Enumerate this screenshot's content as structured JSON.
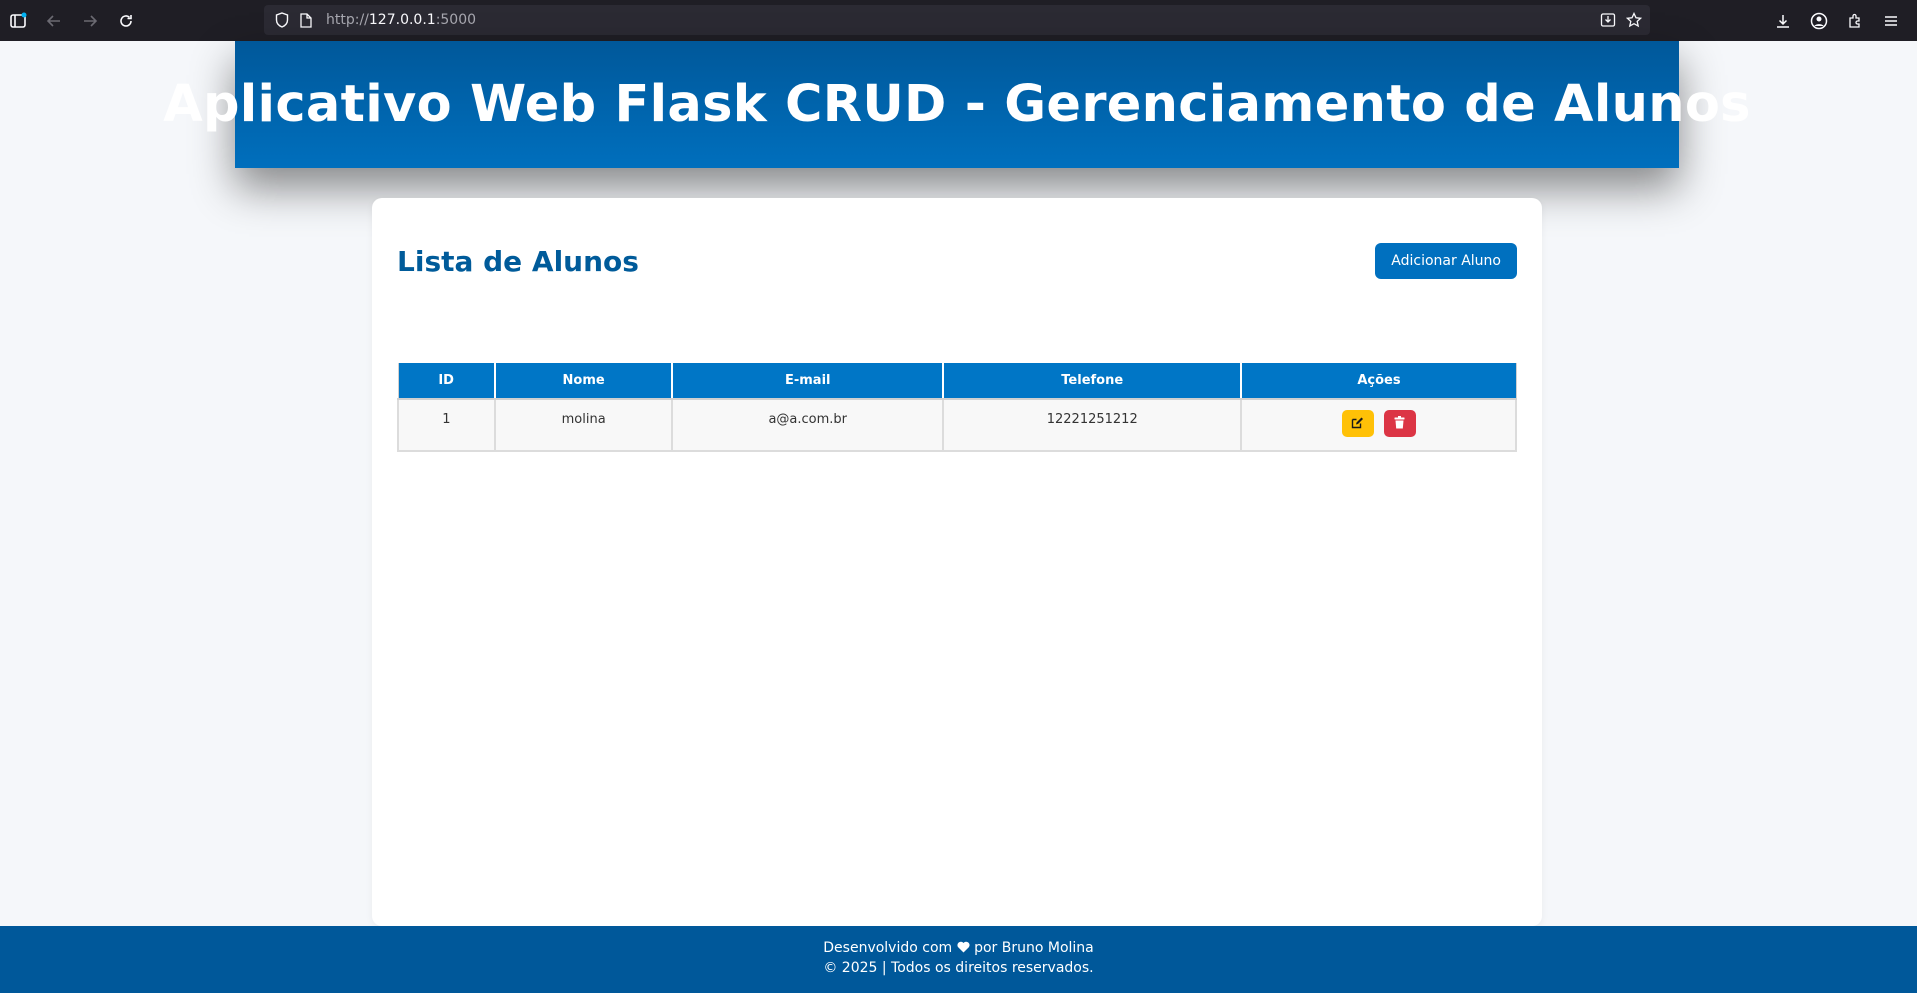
{
  "browser": {
    "url_prefix": "http://",
    "url_host": "127.0.0.1",
    "url_port": ":5000"
  },
  "header": {
    "title": "Aplicativo Web Flask CRUD - Gerenciamento de Alunos"
  },
  "main": {
    "section_title": "Lista de Alunos",
    "add_button_label": "Adicionar Aluno",
    "table": {
      "columns": [
        "ID",
        "Nome",
        "E-mail",
        "Telefone",
        "Ações"
      ],
      "rows": [
        {
          "id": "1",
          "nome": "molina",
          "email": "a@a.com.br",
          "telefone": "12221251212"
        }
      ]
    }
  },
  "footer": {
    "line1_prefix": "Desenvolvido com",
    "line1_suffix": "por Bruno Molina",
    "line2": "© 2025 | Todos os direitos reservados."
  },
  "colors": {
    "primary": "#0070bf",
    "header_dark": "#00589a",
    "edit": "#ffc107",
    "delete": "#dc3545"
  }
}
